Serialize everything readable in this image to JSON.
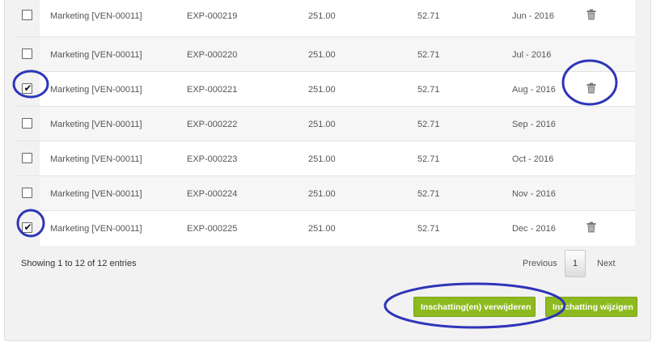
{
  "rows": [
    {
      "vendor": "Marketing [VEN-00011]",
      "expense": "EXP-000219",
      "amount": "251.00",
      "tax": "52.71",
      "period": "Jun - 2016",
      "checked": false,
      "trash": true
    },
    {
      "vendor": "Marketing [VEN-00011]",
      "expense": "EXP-000220",
      "amount": "251.00",
      "tax": "52.71",
      "period": "Jul - 2016",
      "checked": false,
      "trash": false
    },
    {
      "vendor": "Marketing [VEN-00011]",
      "expense": "EXP-000221",
      "amount": "251.00",
      "tax": "52.71",
      "period": "Aug - 2016",
      "checked": true,
      "trash": true
    },
    {
      "vendor": "Marketing [VEN-00011]",
      "expense": "EXP-000222",
      "amount": "251.00",
      "tax": "52.71",
      "period": "Sep - 2016",
      "checked": false,
      "trash": false
    },
    {
      "vendor": "Marketing [VEN-00011]",
      "expense": "EXP-000223",
      "amount": "251.00",
      "tax": "52.71",
      "period": "Oct - 2016",
      "checked": false,
      "trash": false
    },
    {
      "vendor": "Marketing [VEN-00011]",
      "expense": "EXP-000224",
      "amount": "251.00",
      "tax": "52.71",
      "period": "Nov - 2016",
      "checked": false,
      "trash": false
    },
    {
      "vendor": "Marketing [VEN-00011]",
      "expense": "EXP-000225",
      "amount": "251.00",
      "tax": "52.71",
      "period": "Dec - 2016",
      "checked": true,
      "trash": true
    }
  ],
  "icons": {
    "trash": "trash-icon",
    "check": "checkmark-icon"
  },
  "footer": {
    "info": "Showing 1 to 12 of 12 entries",
    "previous": "Previous",
    "page": "1",
    "next": "Next"
  },
  "buttons": {
    "delete": "Inschatting(en) verwijderen",
    "edit": "Inschatting wijzigen"
  },
  "colors": {
    "accent": "#8dba1e",
    "annotation": "#2e35b8",
    "panel": "#f3f2f2"
  }
}
